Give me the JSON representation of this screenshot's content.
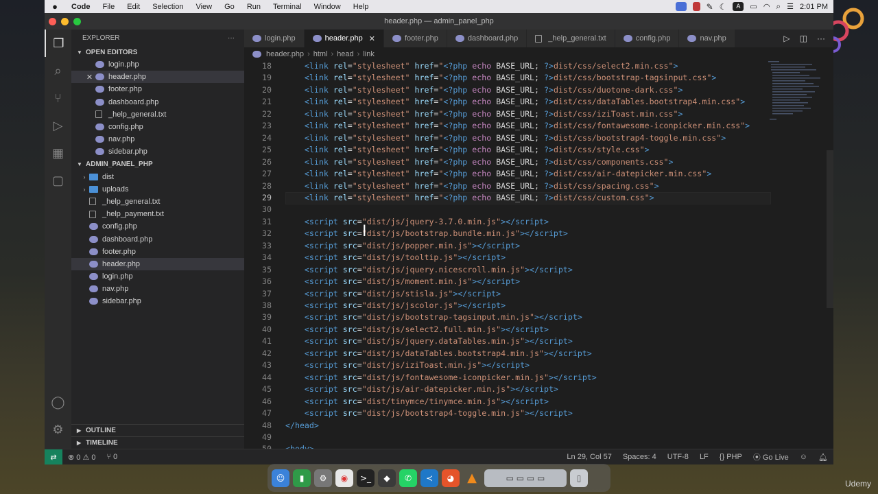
{
  "menubar": {
    "app_name": "Code",
    "items": [
      "File",
      "Edit",
      "Selection",
      "View",
      "Go",
      "Run",
      "Terminal",
      "Window",
      "Help"
    ],
    "clock": "2:01 PM"
  },
  "window": {
    "title": "header.php — admin_panel_php"
  },
  "explorer": {
    "title": "EXPLORER",
    "open_editors_label": "OPEN EDITORS",
    "open_editors": [
      {
        "name": "login.php",
        "kind": "php"
      },
      {
        "name": "header.php",
        "kind": "php",
        "selected": true
      },
      {
        "name": "footer.php",
        "kind": "php"
      },
      {
        "name": "dashboard.php",
        "kind": "php"
      },
      {
        "name": "_help_general.txt",
        "kind": "txt"
      },
      {
        "name": "config.php",
        "kind": "php"
      },
      {
        "name": "nav.php",
        "kind": "php"
      },
      {
        "name": "sidebar.php",
        "kind": "php"
      }
    ],
    "project_label": "ADMIN_PANEL_PHP",
    "tree": [
      {
        "name": "dist",
        "kind": "folder"
      },
      {
        "name": "uploads",
        "kind": "folder"
      },
      {
        "name": "_help_general.txt",
        "kind": "txt"
      },
      {
        "name": "_help_payment.txt",
        "kind": "txt"
      },
      {
        "name": "config.php",
        "kind": "php"
      },
      {
        "name": "dashboard.php",
        "kind": "php"
      },
      {
        "name": "footer.php",
        "kind": "php"
      },
      {
        "name": "header.php",
        "kind": "php",
        "selected": true
      },
      {
        "name": "login.php",
        "kind": "php"
      },
      {
        "name": "nav.php",
        "kind": "php"
      },
      {
        "name": "sidebar.php",
        "kind": "php"
      }
    ],
    "outline_label": "OUTLINE",
    "timeline_label": "TIMELINE"
  },
  "tabs": [
    {
      "name": "login.php",
      "kind": "php"
    },
    {
      "name": "header.php",
      "kind": "php",
      "active": true
    },
    {
      "name": "footer.php",
      "kind": "php"
    },
    {
      "name": "dashboard.php",
      "kind": "php"
    },
    {
      "name": "_help_general.txt",
      "kind": "txt"
    },
    {
      "name": "config.php",
      "kind": "php"
    },
    {
      "name": "nav.php",
      "kind": "php"
    }
  ],
  "breadcrumb": [
    "header.php",
    "html",
    "head",
    "link"
  ],
  "editor": {
    "first_line": 18,
    "current_line": 29,
    "stylesheets": [
      "dist/css/select2.min.css",
      "dist/css/bootstrap-tagsinput.css",
      "dist/css/duotone-dark.css",
      "dist/css/dataTables.bootstrap4.min.css",
      "dist/css/iziToast.min.css",
      "dist/css/fontawesome-iconpicker.min.css",
      "dist/css/bootstrap4-toggle.min.css",
      "dist/css/style.css",
      "dist/css/components.css",
      "dist/css/air-datepicker.min.css",
      "dist/css/spacing.css",
      "dist/css/custom.css"
    ],
    "scripts": [
      "dist/js/jquery-3.7.0.min.js",
      "dist/js/bootstrap.bundle.min.js",
      "dist/js/popper.min.js",
      "dist/js/tooltip.js",
      "dist/js/jquery.nicescroll.min.js",
      "dist/js/moment.min.js",
      "dist/js/stisla.js",
      "dist/js/jscolor.js",
      "dist/js/bootstrap-tagsinput.min.js",
      "dist/js/select2.full.min.js",
      "dist/js/jquery.dataTables.min.js",
      "dist/js/dataTables.bootstrap4.min.js",
      "dist/js/iziToast.min.js",
      "dist/js/fontawesome-iconpicker.min.js",
      "dist/js/air-datepicker.min.js",
      "dist/tinymce/tinymce.min.js",
      "dist/js/bootstrap4-toggle.min.js"
    ],
    "closing_head": "</head>",
    "body_open": "<body>"
  },
  "statusbar": {
    "errors": "0",
    "warnings": "0",
    "ports": "0",
    "position": "Ln 29, Col 57",
    "spaces": "Spaces: 4",
    "encoding": "UTF-8",
    "eol": "LF",
    "language": "PHP",
    "golive": "Go Live"
  },
  "dock_apps": [
    "finder",
    "numbers",
    "settings",
    "chrome",
    "terminal",
    "tableplus",
    "whatsapp",
    "vscode",
    "firefox",
    "vlc",
    "image-previews",
    "trash"
  ],
  "watermark": "Udemy",
  "colors": {
    "accent": "#16825d",
    "php_icon": "#8c8fc8",
    "folder": "#4b90d6"
  }
}
